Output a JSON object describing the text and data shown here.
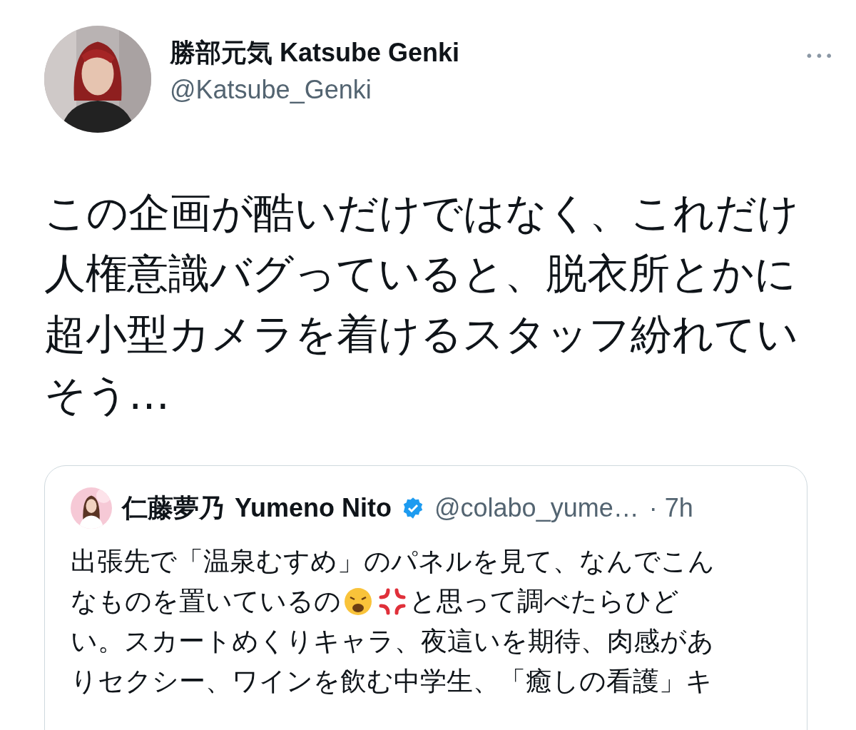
{
  "tweet": {
    "author": {
      "name": "勝部元気 Katsube Genki",
      "handle": "@Katsube_Genki"
    },
    "more": "•••",
    "lines": [
      "この企画が酷いだけではなく、これだけ",
      "人権意識バグっていると、脱衣所とかに",
      "超小型カメラを着けるスタッフ紛れてい",
      "そう…"
    ],
    "quote": {
      "author": {
        "name": "仁藤夢乃",
        "name_latin": "Yumeno Nito",
        "verified": true,
        "handle": "@colabo_yume…",
        "time": "· 7h"
      },
      "lines": [
        {
          "kind": "text",
          "text": "出張先で「温泉むすめ」のパネルを見て、なんでこん"
        },
        {
          "kind": "emoji_split",
          "before": "なものを置いているの",
          "after": "と思って調べたらひど"
        },
        {
          "kind": "text",
          "text": "い。スカートめくりキャラ、夜這いを期待、肉感があ"
        },
        {
          "kind": "text",
          "text": "りセクシー、ワインを飲む中学生、「癒しの看護」キ"
        }
      ]
    }
  }
}
